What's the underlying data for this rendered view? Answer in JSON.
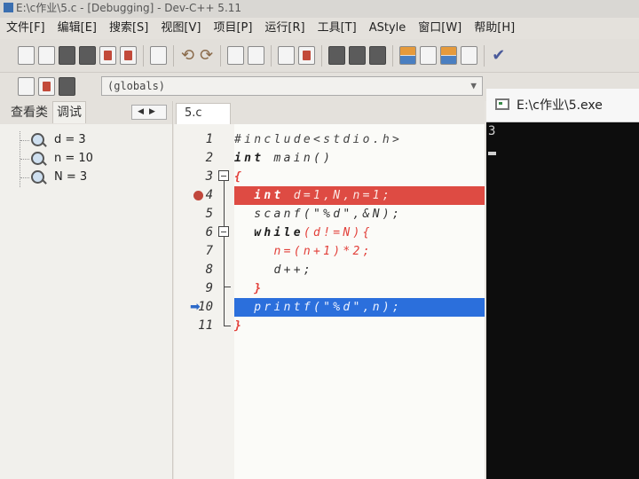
{
  "window": {
    "title": "E:\\c作业\\5.c - [Debugging] - Dev-C++ 5.11"
  },
  "menu": [
    "文件[F]",
    "编辑[E]",
    "搜索[S]",
    "视图[V]",
    "项目[P]",
    "运行[R]",
    "工具[T]",
    "AStyle",
    "窗口[W]",
    "帮助[H]"
  ],
  "toolbar": {
    "function_combo": "(globals)"
  },
  "left_panel": {
    "tabs": [
      "查看类",
      "调试"
    ],
    "active_tab": "调试",
    "watches": [
      "d = 3",
      "n = 10",
      "N = 3"
    ]
  },
  "editor": {
    "tab": "5.c",
    "line_numbers": [
      "1",
      "2",
      "3",
      "4",
      "5",
      "6",
      "7",
      "8",
      "9",
      "10",
      "11"
    ],
    "lines": [
      {
        "kw": "",
        "text": "#include<stdio.h>"
      },
      {
        "kw": "int",
        "text": " main()"
      },
      {
        "kw": "",
        "text": "{"
      },
      {
        "kw": "  int",
        "text": " d=1,N,n=1;"
      },
      {
        "kw": "",
        "text": "  scanf(\"%d\",&N);"
      },
      {
        "kw": "  while",
        "text": "(d!=N){"
      },
      {
        "kw": "",
        "text": "    n=(n+1)*2;"
      },
      {
        "kw": "",
        "text": "    d++;"
      },
      {
        "kw": "",
        "text": "  }"
      },
      {
        "kw": "",
        "text": "  printf(\"%d\",n);"
      },
      {
        "kw": "",
        "text": "}"
      }
    ],
    "breakpoint_line": 4,
    "execution_line": 10,
    "colors": {
      "breakpoint": "#de4b43",
      "execution": "#2b6fdc"
    }
  },
  "console": {
    "title": "E:\\c作业\\5.exe",
    "output": "3"
  }
}
